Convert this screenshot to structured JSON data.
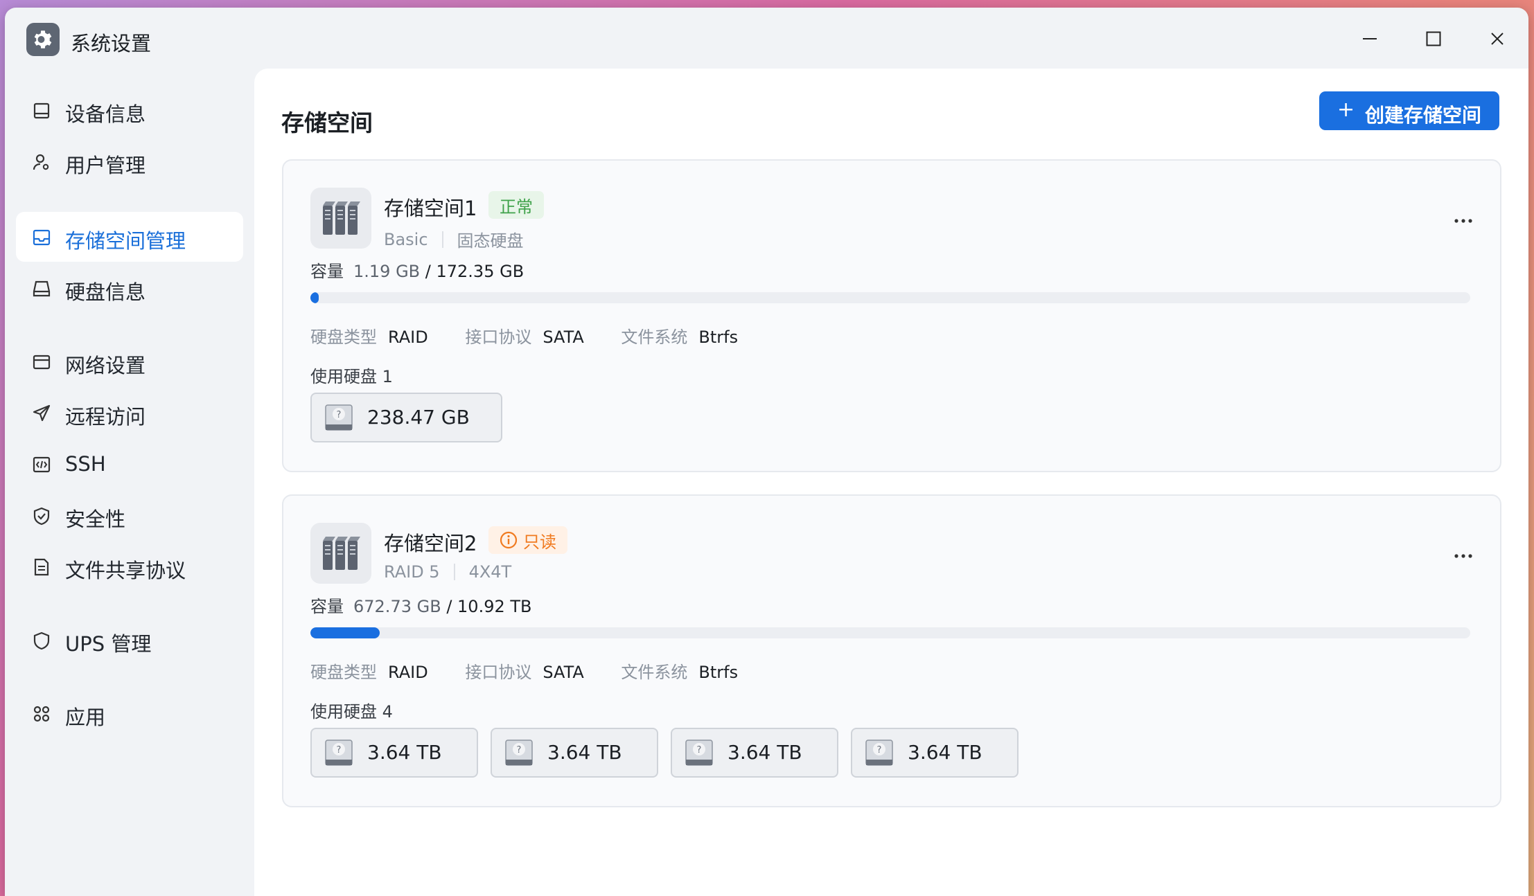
{
  "window": {
    "title": "系统设置",
    "app_icon": "gear-icon"
  },
  "sidebar": {
    "items": [
      {
        "label": "设备信息",
        "icon": "device-icon",
        "active": false
      },
      {
        "label": "用户管理",
        "icon": "user-gear-icon",
        "active": false
      },
      {
        "label": "存储空间管理",
        "icon": "storage-icon",
        "active": true
      },
      {
        "label": "硬盘信息",
        "icon": "disk-icon",
        "active": false
      },
      {
        "label": "网络设置",
        "icon": "network-icon",
        "active": false
      },
      {
        "label": "远程访问",
        "icon": "send-icon",
        "active": false
      },
      {
        "label": "SSH",
        "icon": "code-icon",
        "active": false
      },
      {
        "label": "安全性",
        "icon": "shield-check-icon",
        "active": false
      },
      {
        "label": "文件共享协议",
        "icon": "document-icon",
        "active": false
      },
      {
        "label": "UPS 管理",
        "icon": "shield-icon",
        "active": false
      },
      {
        "label": "应用",
        "icon": "apps-icon",
        "active": false
      }
    ]
  },
  "main": {
    "title": "存储空间",
    "create_button": "创建存储空间",
    "pools": [
      {
        "name": "存储空间1",
        "status": "正常",
        "type": "Basic",
        "media": "固态硬盘",
        "capacity_label": "容量",
        "used": "1.19 GB",
        "total": "/ 172.35 GB",
        "usage_fraction": 0.0069,
        "props": [
          {
            "k": "硬盘类型",
            "v": "RAID"
          },
          {
            "k": "接口协议",
            "v": "SATA"
          },
          {
            "k": "文件系统",
            "v": "Btrfs"
          }
        ],
        "disks_label": "使用硬盘 1",
        "disks": [
          "238.47 GB"
        ]
      },
      {
        "name": "存储空间2",
        "status": "只读",
        "type": "RAID 5",
        "media": "4X4T",
        "capacity_label": "容量",
        "used": "672.73 GB",
        "total": "/ 10.92 TB",
        "usage_fraction": 0.06,
        "props": [
          {
            "k": "硬盘类型",
            "v": "RAID"
          },
          {
            "k": "接口协议",
            "v": "SATA"
          },
          {
            "k": "文件系统",
            "v": "Btrfs"
          }
        ],
        "disks_label": "使用硬盘 4",
        "disks": [
          "3.64 TB",
          "3.64 TB",
          "3.64 TB",
          "3.64 TB"
        ]
      }
    ]
  },
  "colors": {
    "accent": "#1a6fe0",
    "ok": "#3fa24a",
    "warn": "#f07a1f"
  }
}
